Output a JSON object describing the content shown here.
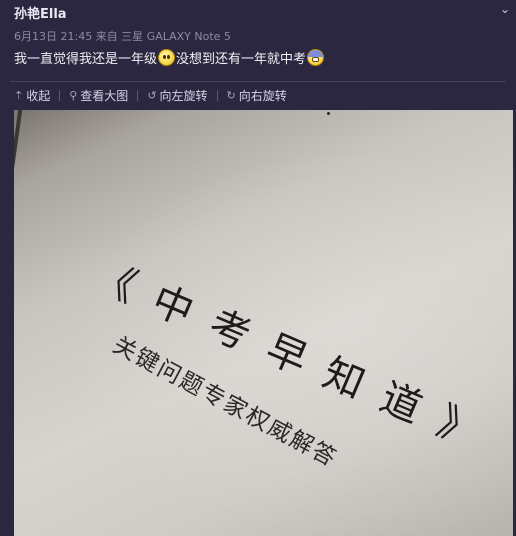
{
  "post": {
    "username": "孙艳Ella",
    "meta": "6月13日 21:45 来自 三星 GALAXY Note 5",
    "text_part1": "我一直觉得我还是一年级",
    "text_part2": "没想到还有一年就中考",
    "emojis": [
      "confused-face-icon",
      "sweat-face-icon"
    ]
  },
  "toolbar": {
    "collapse": {
      "label": "收起",
      "icon": "collapse-arrow-icon"
    },
    "view_large": {
      "label": "查看大图",
      "icon": "magnifier-icon"
    },
    "rotate_left": {
      "label": "向左旋转",
      "icon": "rotate-left-icon"
    },
    "rotate_right": {
      "label": "向右旋转",
      "icon": "rotate-right-icon"
    }
  },
  "photo": {
    "book_title": "《中考早知道》",
    "book_subtitle": "关键问题专家权威解答"
  }
}
